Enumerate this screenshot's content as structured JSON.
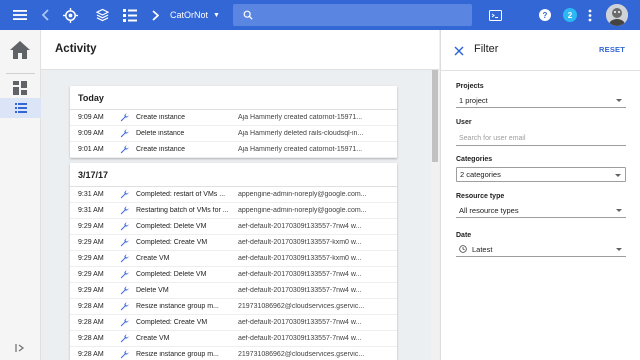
{
  "topbar": {
    "project_name": "CatOrNot",
    "notification_count": "2",
    "colors": {
      "bar": "#3367d6",
      "search": "#5a86e2",
      "badge": "#2bb8f4"
    }
  },
  "page": {
    "title": "Activity"
  },
  "activity": {
    "groups": [
      {
        "heading": "Today",
        "rows": [
          {
            "time": "9:09 AM",
            "activity": "Create instance",
            "description": "Aja Hammerly created catornot-15971..."
          },
          {
            "time": "9:09 AM",
            "activity": "Delete instance",
            "description": "Aja Hammerly deleted rails-cloudsql-in..."
          },
          {
            "time": "9:01 AM",
            "activity": "Create instance",
            "description": "Aja Hammerly created catornot-15971..."
          }
        ]
      },
      {
        "heading": "3/17/17",
        "rows": [
          {
            "time": "9:31 AM",
            "activity": "Completed: restart of VMs ...",
            "description": "appengine-admin-noreply@google.com..."
          },
          {
            "time": "9:31 AM",
            "activity": "Restarting batch of VMs for ...",
            "description": "appengine-admin-noreply@google.com..."
          },
          {
            "time": "9:29 AM",
            "activity": "Completed: Delete VM",
            "description": "aef-default-20170309t133557-7nw4 w..."
          },
          {
            "time": "9:29 AM",
            "activity": "Completed: Create VM",
            "description": "aef-default-20170309t133557-kxm0 w..."
          },
          {
            "time": "9:29 AM",
            "activity": "Create VM",
            "description": "aef-default-20170309t133557-kxm0 w..."
          },
          {
            "time": "9:29 AM",
            "activity": "Completed: Delete VM",
            "description": "aef-default-20170309t133557-7nw4 w..."
          },
          {
            "time": "9:29 AM",
            "activity": "Delete VM",
            "description": "aef-default-20170309t133557-7nw4 w..."
          },
          {
            "time": "9:28 AM",
            "activity": "Resize instance group m...",
            "description": "219731086962@cloudservices.gservic..."
          },
          {
            "time": "9:28 AM",
            "activity": "Completed: Create VM",
            "description": "aef-default-20170309t133557-7nw4 w..."
          },
          {
            "time": "9:28 AM",
            "activity": "Create VM",
            "description": "aef-default-20170309t133557-7nw4 w..."
          },
          {
            "time": "9:28 AM",
            "activity": "Resize instance group m...",
            "description": "219731086962@cloudservices.gservic..."
          }
        ]
      }
    ]
  },
  "filter": {
    "title": "Filter",
    "reset_label": "RESET",
    "projects": {
      "label": "Projects",
      "value": "1 project"
    },
    "user": {
      "label": "User",
      "placeholder": "Search for user email"
    },
    "categories": {
      "label": "Categories",
      "value": "2 categories"
    },
    "resource_type": {
      "label": "Resource type",
      "value": "All resource types"
    },
    "date": {
      "label": "Date",
      "value": "Latest"
    },
    "colors": {
      "accent": "#3367d6"
    }
  }
}
